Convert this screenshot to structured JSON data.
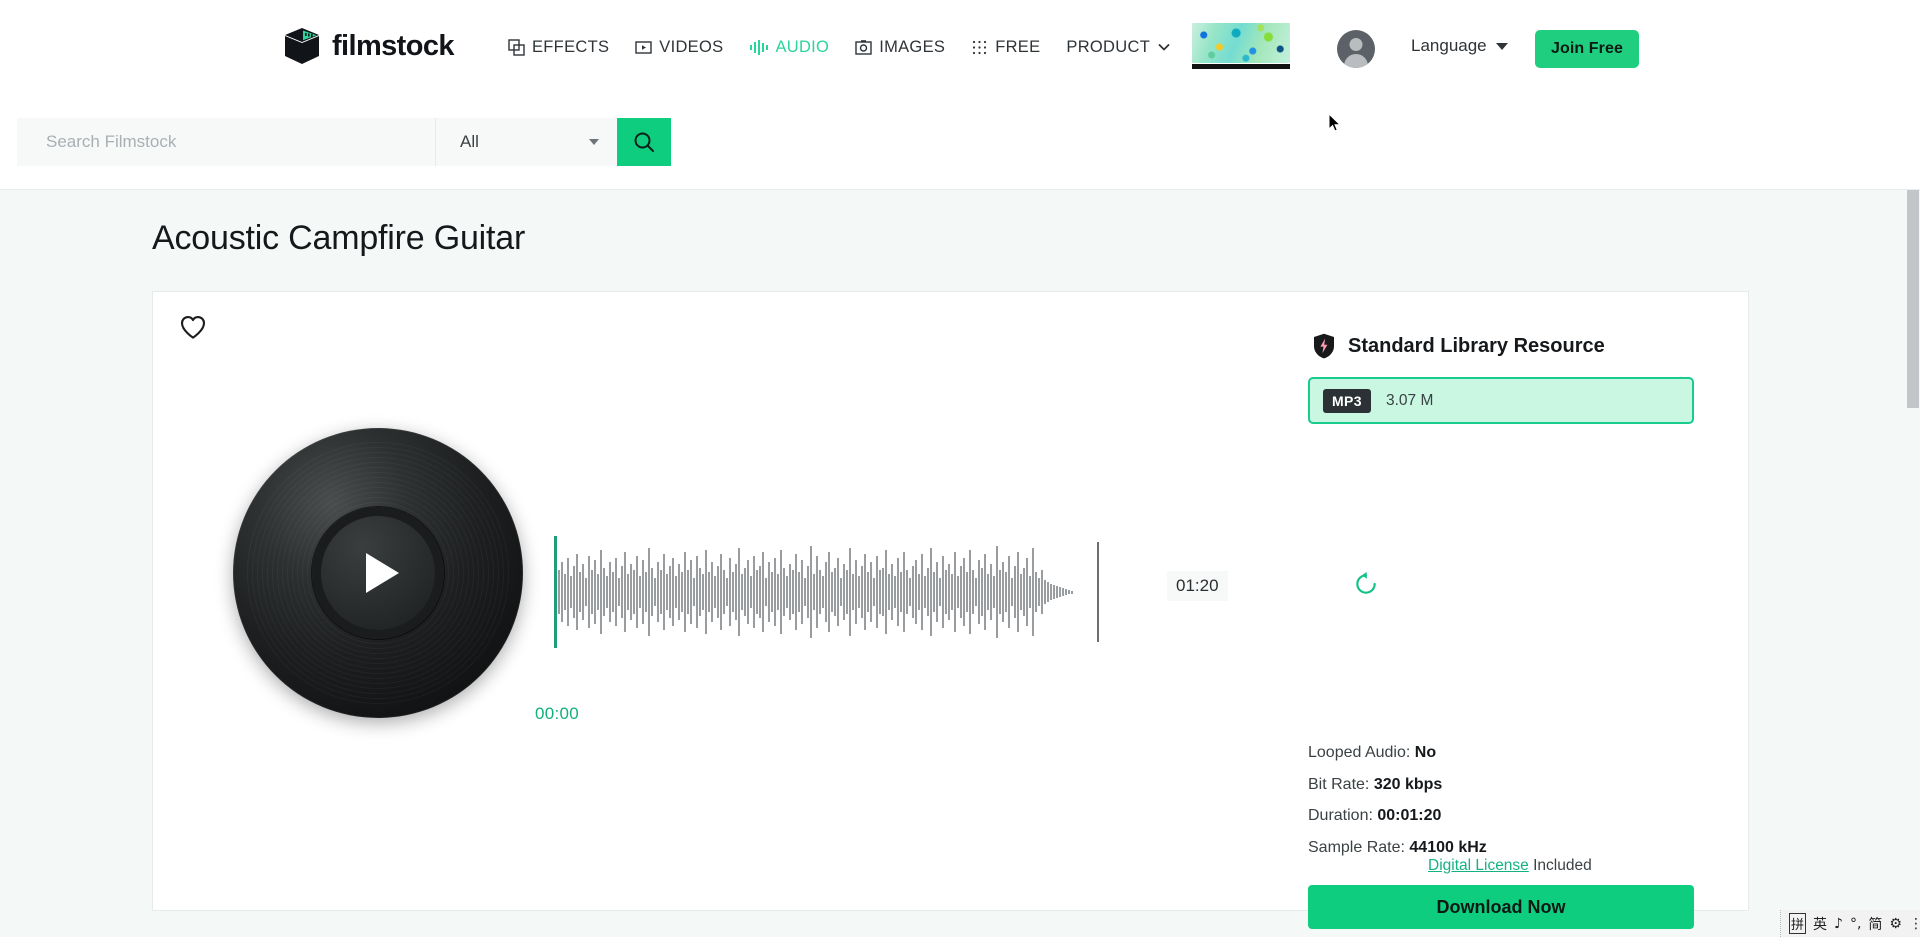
{
  "header": {
    "brand": "filmstock",
    "nav": [
      {
        "label": "EFFECTS",
        "icon": "effects-layers-icon",
        "active": false
      },
      {
        "label": "VIDEOS",
        "icon": "video-play-icon",
        "active": false
      },
      {
        "label": "AUDIO",
        "icon": "audio-waveform-icon",
        "active": true
      },
      {
        "label": "IMAGES",
        "icon": "camera-icon",
        "active": false
      },
      {
        "label": "FREE",
        "icon": "grid-dots-icon",
        "active": false
      },
      {
        "label": "PRODUCT",
        "icon": "chevron-down-icon",
        "active": false
      }
    ],
    "promo_alt": "promo-banner",
    "language_label": "Language",
    "join_label": "Join Free",
    "accent_green": "#20ce7f"
  },
  "search": {
    "placeholder": "Search Filmstock",
    "value": "",
    "category": "All",
    "submit_icon": "search-icon"
  },
  "page": {
    "title": "Acoustic Campfire Guitar"
  },
  "player": {
    "favorite_icon": "heart-icon",
    "play_icon": "play-icon",
    "current_time": "00:00",
    "total_time": "01:20",
    "loop_icon": "replay-loop-icon"
  },
  "resource": {
    "badge_icon": "shield-bolt-icon",
    "title": "Standard Library Resource",
    "format_chip": "MP3",
    "format_size": "3.07 M",
    "meta": [
      {
        "label": "Looped Audio:",
        "value": "No"
      },
      {
        "label": "Bit Rate:",
        "value": "320 kbps"
      },
      {
        "label": "Duration:",
        "value": "00:01:20"
      },
      {
        "label": "Sample Rate:",
        "value": "44100 kHz"
      }
    ],
    "license_link": "Digital License",
    "license_suffix": "Included",
    "download_label": "Download Now"
  },
  "taskbar": {
    "ime_mode": "拼",
    "ime_lang": "英",
    "ime_tone": "♪",
    "ime_punct": "°,",
    "ime_simplified": "简",
    "ime_settings": "⚙",
    "ime_more": "⋮"
  }
}
